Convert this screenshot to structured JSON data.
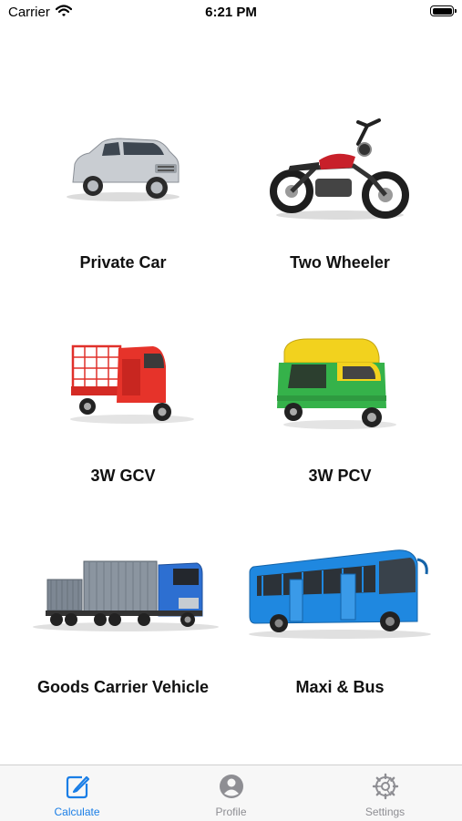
{
  "status_bar": {
    "carrier": "Carrier",
    "time": "6:21 PM"
  },
  "vehicles": [
    {
      "label": "Private Car",
      "icon": "suv-car-image"
    },
    {
      "label": "Two Wheeler",
      "icon": "motorcycle-image"
    },
    {
      "label": "3W GCV",
      "icon": "cargo-three-wheeler-image"
    },
    {
      "label": "3W PCV",
      "icon": "auto-rickshaw-image"
    },
    {
      "label": "Goods Carrier Vehicle",
      "icon": "truck-trailer-image"
    },
    {
      "label": "Maxi & Bus",
      "icon": "bus-image"
    }
  ],
  "tab_bar": {
    "items": [
      {
        "label": "Calculate",
        "icon": "edit-icon",
        "active": true
      },
      {
        "label": "Profile",
        "icon": "person-icon",
        "active": false
      },
      {
        "label": "Settings",
        "icon": "gear-icon",
        "active": false
      }
    ]
  },
  "colors": {
    "accent": "#1a7ee6",
    "inactive": "#8e8e93"
  }
}
